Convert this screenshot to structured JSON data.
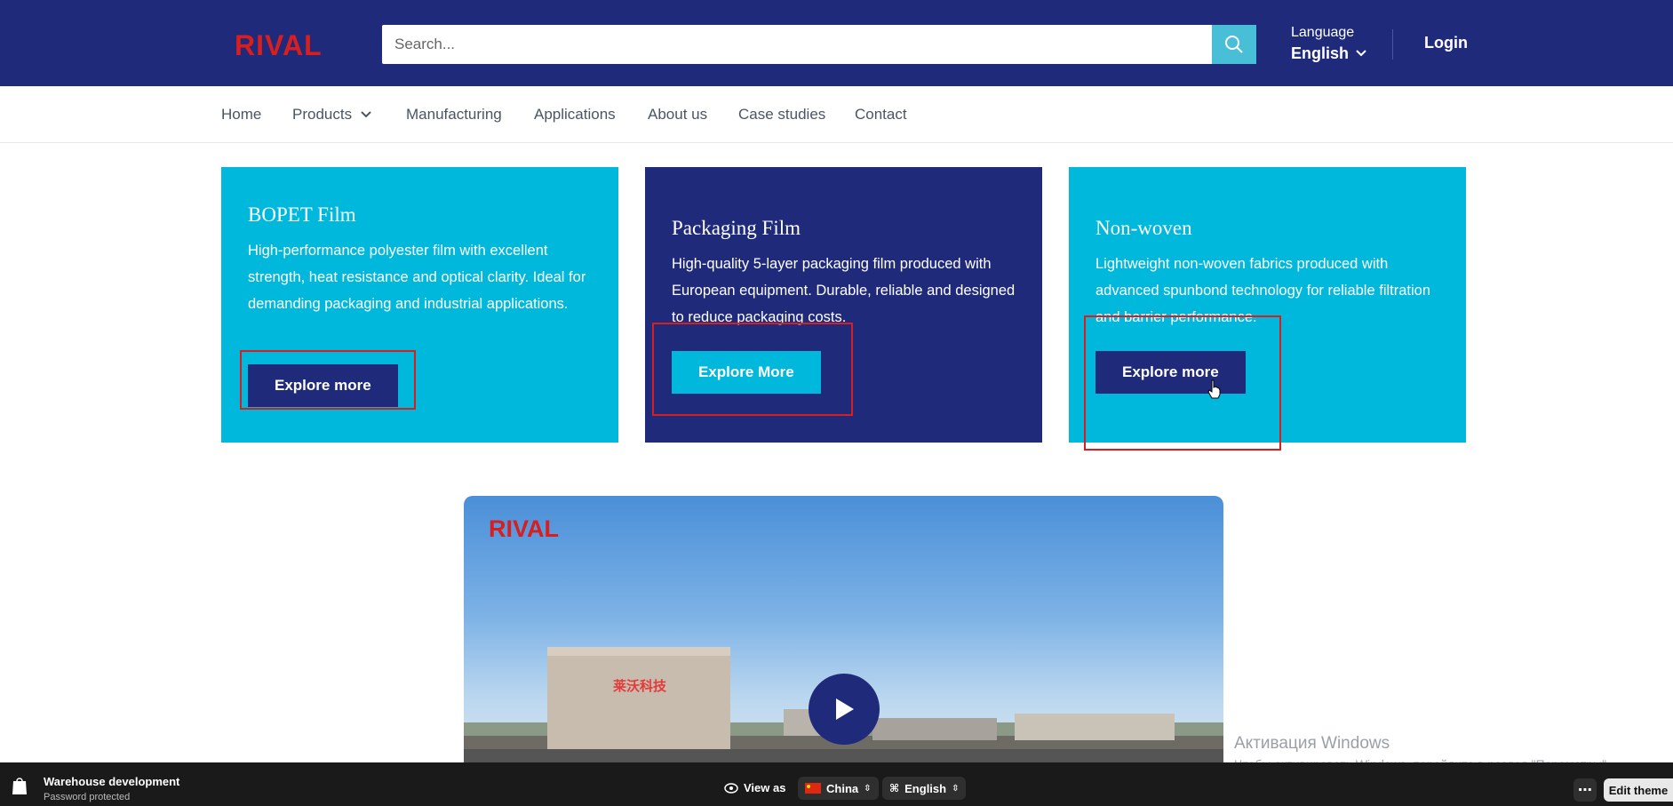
{
  "header": {
    "logo_text": "RIVAL",
    "search_placeholder": "Search...",
    "language_label": "Language",
    "language_value": "English",
    "login_label": "Login"
  },
  "nav": {
    "items": [
      "Home",
      "Products",
      "Manufacturing",
      "Applications",
      "About us",
      "Case studies",
      "Contact"
    ]
  },
  "cards": [
    {
      "title": "BOPET Film",
      "text": "High-performance polyester film with excellent strength, heat resistance and optical clarity. Ideal for demanding packaging and industrial applications.",
      "button": "Explore more"
    },
    {
      "title": "Packaging Film",
      "text": "High-quality 5-layer packaging film produced with European equipment. Durable, reliable and designed to reduce packaging costs.",
      "button": "Explore More"
    },
    {
      "title": "Non-woven",
      "text": "Lightweight non-woven fabrics produced with advanced spunbond technology for reliable filtration and barrier performance.",
      "button": "Explore more"
    }
  ],
  "video": {
    "logo_text": "RIVAL",
    "building_sign": "莱沃科技"
  },
  "windows_activation": {
    "title": "Активация Windows",
    "subtitle": "Чтобы активировать Windows, перейдите в раздел \"Параметры\"."
  },
  "bottom_bar": {
    "store_name": "Warehouse development",
    "password_text": "Password protected",
    "view_as": "View as",
    "country": "China",
    "language": "English",
    "edit_theme": "Edit theme"
  },
  "colors": {
    "navy": "#1f2a7a",
    "cyan": "#00b8dc",
    "brand_red": "#d81e1e"
  }
}
